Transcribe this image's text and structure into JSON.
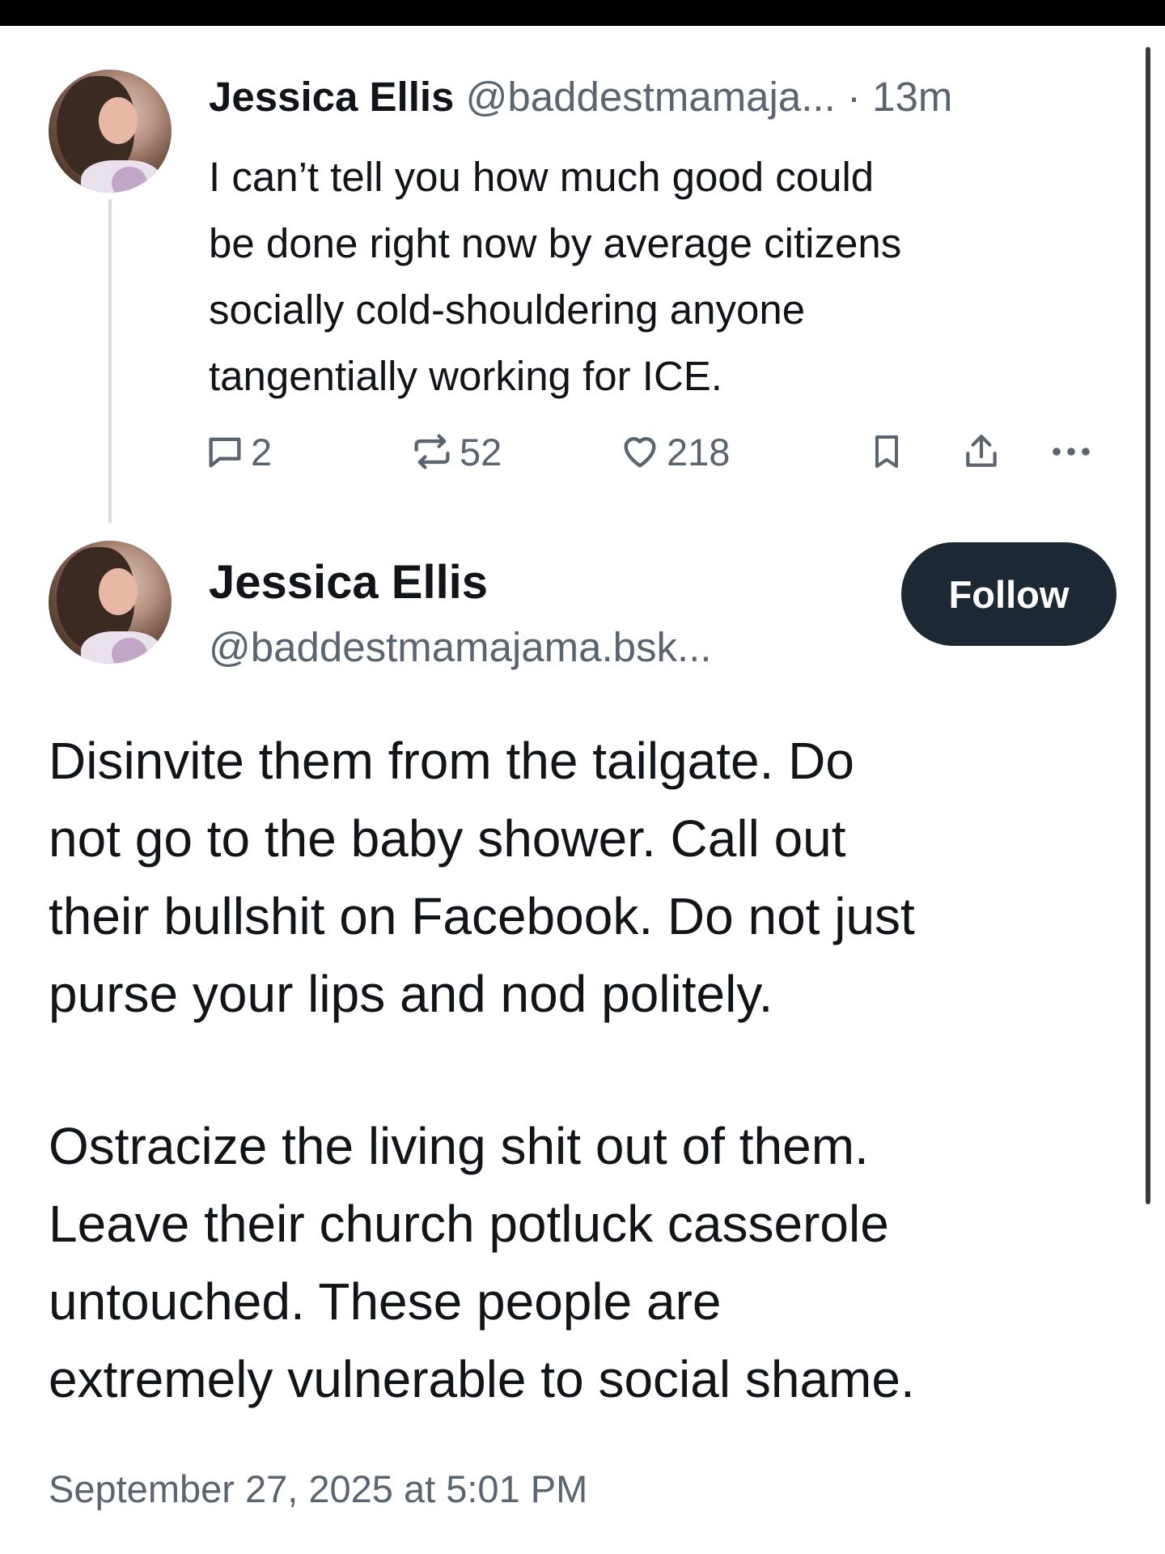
{
  "parent_post": {
    "author_name": "Jessica Ellis",
    "author_handle": "@baddestmamaja...",
    "separator": "·",
    "time_ago": "13m",
    "text_lines": [
      "I can’t tell you how much good could",
      "be done right now by average citizens",
      "socially cold-shouldering anyone",
      "tangentially working for ICE."
    ],
    "actions": {
      "reply_icon": "comment-icon",
      "reply_count": "2",
      "repost_icon": "repost-icon",
      "repost_count": "52",
      "like_icon": "heart-icon",
      "like_count": "218",
      "bookmark_icon": "bookmark-icon",
      "share_icon": "share-icon",
      "more_icon": "more-icon"
    }
  },
  "main_post": {
    "author_name": "Jessica Ellis",
    "author_handle": "@baddestmamajama.bsk...",
    "follow_label": "Follow",
    "paragraph1_lines": [
      "Disinvite them from the tailgate. Do",
      "not go to the baby shower. Call out",
      "their bullshit on Facebook. Do not just",
      "purse your lips and nod politely."
    ],
    "paragraph2_lines": [
      "Ostracize the living shit out of them.",
      "Leave their church potluck casserole",
      "untouched. These people are",
      "extremely vulnerable to social shame."
    ],
    "timestamp": "September 27, 2025 at 5:01 PM"
  },
  "colors": {
    "text": "#111418",
    "muted": "#5b6570",
    "follow_button_bg": "#1c2833",
    "thread_line": "#d9dde2",
    "top_bar": "#000000"
  }
}
